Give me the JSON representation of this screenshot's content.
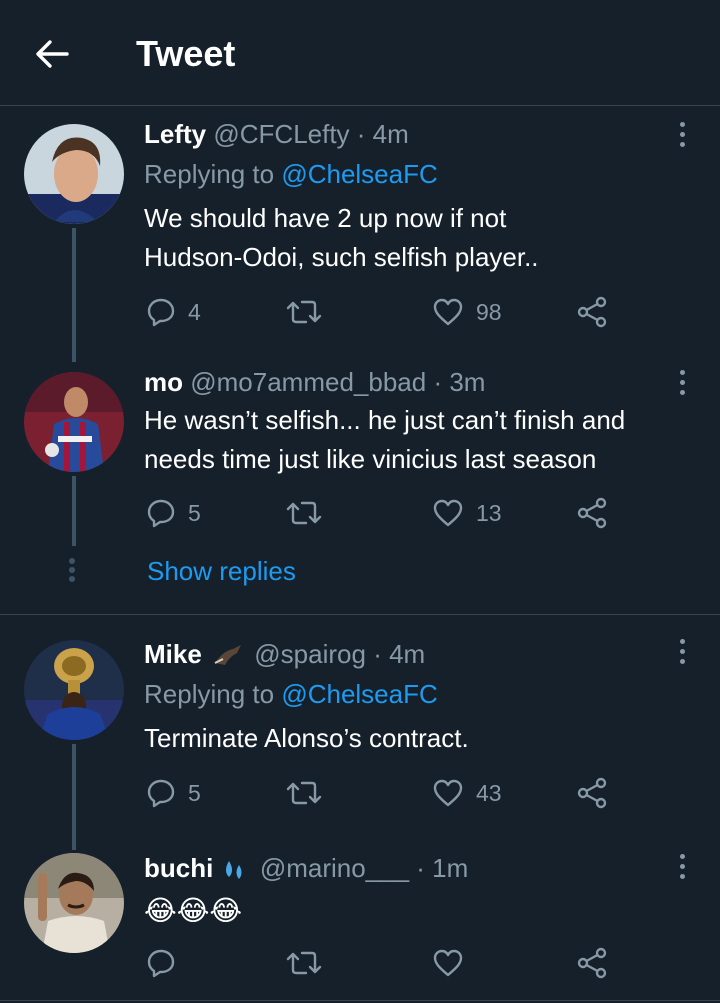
{
  "header": {
    "title": "Tweet"
  },
  "tweets": [
    {
      "name": "Lefty",
      "handle": "@CFCLefty",
      "time": "· 4m",
      "reply_prefix": "Replying to ",
      "reply_handle": "@ChelseaFC",
      "text_line1": "We should have 2 up now if not",
      "text_line2": "Hudson-Odoi, such selfish player..",
      "replies": "4",
      "retweets": "",
      "likes": "98"
    },
    {
      "name": "mo",
      "handle": "@mo7ammed_bbad",
      "time": "· 3m",
      "text_line1": "He wasn’t selfish... he just can’t finish and",
      "text_line2": "needs time just like vinicius last season",
      "replies": "5",
      "retweets": "",
      "likes": "13"
    },
    {
      "name": "Mike",
      "handle": "@spairog",
      "time": "· 4m",
      "reply_prefix": "Replying to ",
      "reply_handle": "@ChelseaFC",
      "text_line1": "Terminate Alonso’s contract.",
      "replies": "5",
      "retweets": "",
      "likes": "43"
    },
    {
      "name": "buchi",
      "handle": "@marino___",
      "time": "· 1m",
      "text_line1": "😂😂😂",
      "replies": "",
      "retweets": "",
      "likes": ""
    }
  ],
  "show_replies": "Show replies",
  "colors": {
    "background": "#15202b",
    "accent": "#1d9bf0",
    "muted": "#8899a6",
    "divider": "#38444d"
  }
}
